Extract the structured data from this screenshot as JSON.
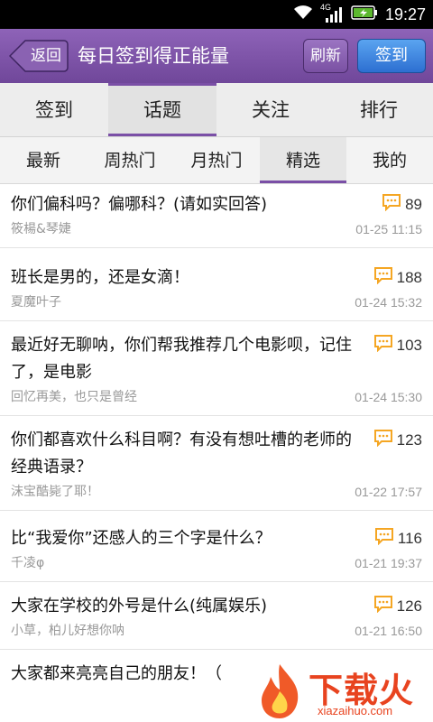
{
  "status_bar": {
    "network": "4G",
    "time": "19:27"
  },
  "header": {
    "back_label": "返回",
    "title": "每日签到得正能量",
    "refresh_label": "刷新",
    "signin_label": "签到"
  },
  "main_tabs": [
    {
      "label": "签到",
      "active": false
    },
    {
      "label": "话题",
      "active": true
    },
    {
      "label": "关注",
      "active": false
    },
    {
      "label": "排行",
      "active": false
    }
  ],
  "sub_tabs": [
    {
      "label": "最新",
      "active": false
    },
    {
      "label": "周热门",
      "active": false
    },
    {
      "label": "月热门",
      "active": false
    },
    {
      "label": "精选",
      "active": true
    },
    {
      "label": "我的",
      "active": false
    }
  ],
  "topics": [
    {
      "title": "你们偏科吗？偏哪科？(请如实回答)",
      "author": "筱楊&琴婕",
      "time": "01-25 11:15",
      "count": "89"
    },
    {
      "title": "班长是男的，还是女滴！",
      "author": "夏魔叶子",
      "time": "01-24 15:32",
      "count": "188"
    },
    {
      "title": "最近好无聊呐，你们帮我推荐几个电影呗，记住了，是电影",
      "author": "回忆再美，也只是曾经",
      "time": "01-24 15:30",
      "count": "103"
    },
    {
      "title": "你们都喜欢什么科目啊？有没有想吐槽的老师的经典语录？",
      "author": "沫宝酷毙了耶！",
      "time": "01-22 17:57",
      "count": "123"
    },
    {
      "title": "比“我爱你”还感人的三个字是什么？",
      "author": "千凌φ",
      "time": "01-21 19:37",
      "count": "116"
    },
    {
      "title": "大家在学校的外号是什么(纯属娱乐)",
      "author": "小草，柏儿好想你呐",
      "time": "01-21 16:50",
      "count": "126"
    },
    {
      "title": "大家都来亮亮自己的朋友！（",
      "author": "",
      "time": "",
      "count": ""
    }
  ],
  "watermark": {
    "text": "下载火",
    "url_text": "xiazaihuo.com"
  },
  "colors": {
    "header_purple": "#7a4fa6",
    "signin_blue": "#2d6fd1",
    "comment_icon_orange": "#f5a623"
  },
  "icons": {
    "comment": "comment-bubble-icon",
    "back": "back-arrow-icon",
    "wifi": "wifi-icon",
    "signal": "signal-icon",
    "battery": "battery-charging-icon"
  }
}
